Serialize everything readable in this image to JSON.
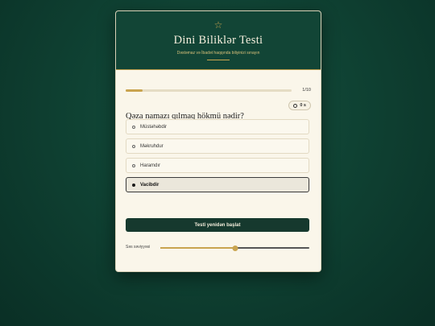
{
  "header": {
    "star_icon": "star-outline-icon",
    "title": "Dini Biliklər Testi",
    "subtitle": "Dəstəmaz və İbadət haqqında biliyinizi sınayın"
  },
  "progress": {
    "fraction": 0.1,
    "count_label": "1/10"
  },
  "timer": {
    "icon": "clock-icon",
    "label": "0 s"
  },
  "question": {
    "text": "Qəza namazı qılmaq hökmü nədir?"
  },
  "options": [
    {
      "label": "Müstəhəbdir",
      "selected": false
    },
    {
      "label": "Məkruhdur",
      "selected": false
    },
    {
      "label": "Haramdır",
      "selected": false
    },
    {
      "label": "Vacibdir",
      "selected": true
    }
  ],
  "restart_button": {
    "label": "Testi yenidən başlat"
  },
  "volume": {
    "label": "Səs səviyyəsi",
    "level": 0.5
  },
  "colors": {
    "accent": "#c9a44f",
    "header_bg": "#124536",
    "button_bg": "#16392e",
    "card_bg": "#faf6ea"
  }
}
